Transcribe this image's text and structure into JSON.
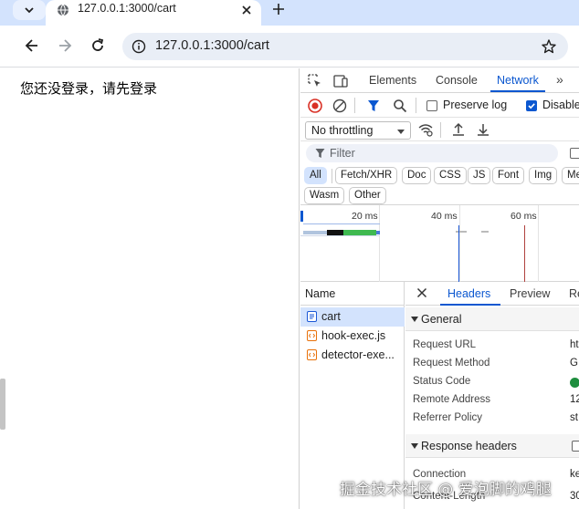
{
  "browser": {
    "tab_title": "127.0.0.1:3000/cart",
    "url": "127.0.0.1:3000/cart"
  },
  "page": {
    "message": "您还没登录，请先登录"
  },
  "devtools": {
    "tabs": [
      "Elements",
      "Console",
      "Network"
    ],
    "active_tab": "Network",
    "preserve_log": "Preserve log",
    "disable_cache": "Disable",
    "throttling": "No throttling",
    "filter_placeholder": "Filter",
    "type_filters": [
      "All",
      "Fetch/XHR",
      "Doc",
      "CSS",
      "JS",
      "Font",
      "Img",
      "Me"
    ],
    "type_filters_row2": [
      "Wasm",
      "Other"
    ],
    "timeline_labels": [
      "20 ms",
      "40 ms",
      "60 ms"
    ],
    "requests_header": "Name",
    "requests": [
      {
        "name": "cart",
        "type": "document"
      },
      {
        "name": "hook-exec.js",
        "type": "script"
      },
      {
        "name": "detector-exe...",
        "type": "script"
      }
    ],
    "detail_tabs": [
      "Headers",
      "Preview",
      "Re"
    ],
    "general_section": "General",
    "general": [
      {
        "key": "Request URL",
        "value": "ht"
      },
      {
        "key": "Request Method",
        "value": "G"
      },
      {
        "key": "Status Code",
        "value": ""
      },
      {
        "key": "Remote Address",
        "value": "12"
      },
      {
        "key": "Referrer Policy",
        "value": "st"
      }
    ],
    "response_section": "Response headers",
    "response_headers": [
      {
        "key": "Connection",
        "value": "ke"
      },
      {
        "key": "Content-Length",
        "value": "30"
      }
    ],
    "colors": {
      "accent": "#0b57d0",
      "status_ok": "#1e8e3e",
      "record": "#d93025"
    }
  },
  "watermark": "掘金技术社区 @ 爱泡脚的鸡腿"
}
